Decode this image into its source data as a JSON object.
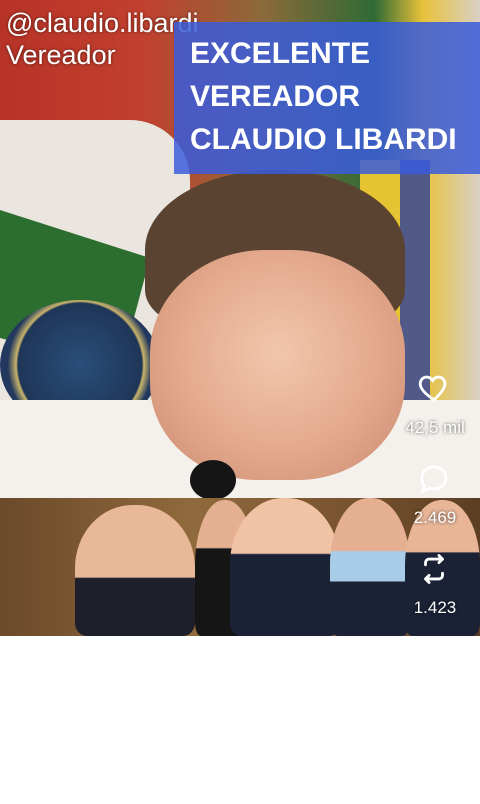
{
  "overlay": {
    "handle": "@claudio.libardi",
    "role": "Vereador",
    "caption_lines": [
      "EXCELENTE",
      "VEREADOR",
      "CLAUDIO LIBARDI"
    ]
  },
  "actions": {
    "likes": "42,5 mil",
    "comments": "2.469",
    "reposts": "1.423"
  },
  "colors": {
    "caption_bg": "#3a5cdc",
    "text": "#ffffff"
  }
}
